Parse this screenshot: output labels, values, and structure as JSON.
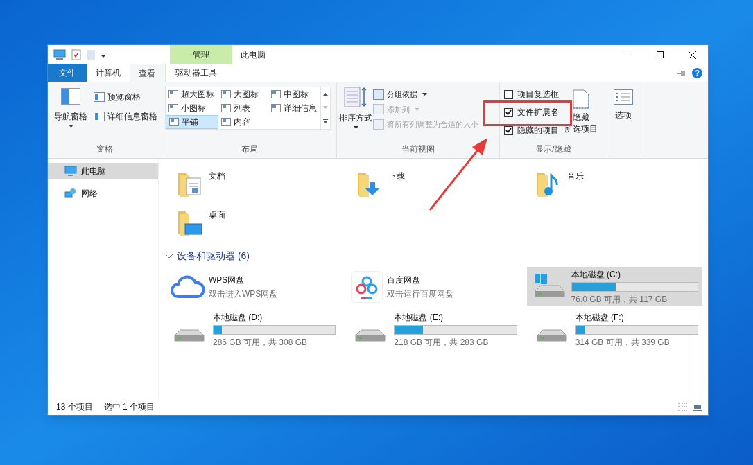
{
  "title_bar": {
    "context_group": "管理",
    "title": "此电脑"
  },
  "tabs": [
    {
      "label": "文件",
      "kind": "file",
      "selected": false
    },
    {
      "label": "计算机",
      "kind": "normal",
      "selected": false
    },
    {
      "label": "查看",
      "kind": "normal",
      "selected": true
    },
    {
      "label": "驱动器工具",
      "kind": "context",
      "selected": false
    }
  ],
  "ribbon": {
    "panes": {
      "label": "窗格",
      "large": "导航窗格",
      "items": [
        "预览窗格",
        "详细信息窗格"
      ]
    },
    "layout": {
      "label": "布局",
      "items": [
        {
          "label": "超大图标",
          "selected": false
        },
        {
          "label": "大图标",
          "selected": false
        },
        {
          "label": "中图标",
          "selected": false
        },
        {
          "label": "小图标",
          "selected": false
        },
        {
          "label": "列表",
          "selected": false
        },
        {
          "label": "详细信息",
          "selected": false
        },
        {
          "label": "平铺",
          "selected": true
        },
        {
          "label": "内容",
          "selected": false
        }
      ]
    },
    "current_view": {
      "label": "当前视图",
      "large": "排序方式",
      "items": [
        {
          "label": "分组依据",
          "disabled": false
        },
        {
          "label": "添加列",
          "disabled": true
        },
        {
          "label": "将所有列调整为合适的大小",
          "disabled": true
        }
      ]
    },
    "show_hide": {
      "label": "显示/隐藏",
      "checkboxes": [
        {
          "label": "项目复选框",
          "checked": false
        },
        {
          "label": "文件扩展名",
          "checked": true
        },
        {
          "label": "隐藏的项目",
          "checked": true
        }
      ],
      "hide_button": [
        "隐藏",
        "所选项目"
      ]
    },
    "options": {
      "label": "选项"
    }
  },
  "nav": [
    {
      "label": "此电脑",
      "kind": "computer",
      "selected": true
    },
    {
      "label": "网络",
      "kind": "network",
      "selected": false
    }
  ],
  "folders": [
    {
      "name": "文档",
      "kind": "documents"
    },
    {
      "name": "下载",
      "kind": "downloads"
    },
    {
      "name": "音乐",
      "kind": "music"
    },
    {
      "name": "桌面",
      "kind": "desktop"
    }
  ],
  "section": {
    "title": "设备和驱动器 (6)",
    "expanded": true
  },
  "drives": [
    {
      "name": "WPS网盘",
      "kind": "cloud",
      "subtitle": "双击进入WPS网盘",
      "selected": false
    },
    {
      "name": "百度网盘",
      "kind": "share",
      "subtitle": "双击运行百度网盘",
      "selected": false
    },
    {
      "name": "本地磁盘 (C:)",
      "kind": "system",
      "level": 0.35,
      "subtitle": "76.0 GB 可用，共 117 GB",
      "selected": true
    },
    {
      "name": "本地磁盘 (D:)",
      "kind": "disk",
      "level": 0.07,
      "subtitle": "286 GB 可用，共 308 GB",
      "selected": false
    },
    {
      "name": "本地磁盘 (E:)",
      "kind": "disk",
      "level": 0.23,
      "subtitle": "218 GB 可用，共 283 GB",
      "selected": false
    },
    {
      "name": "本地磁盘 (F:)",
      "kind": "disk",
      "level": 0.074,
      "subtitle": "314 GB 可用，共 339 GB",
      "selected": false
    }
  ],
  "help": "?",
  "status_bar": {
    "count": "13 个项目",
    "selection": "选中 1 个项目"
  }
}
